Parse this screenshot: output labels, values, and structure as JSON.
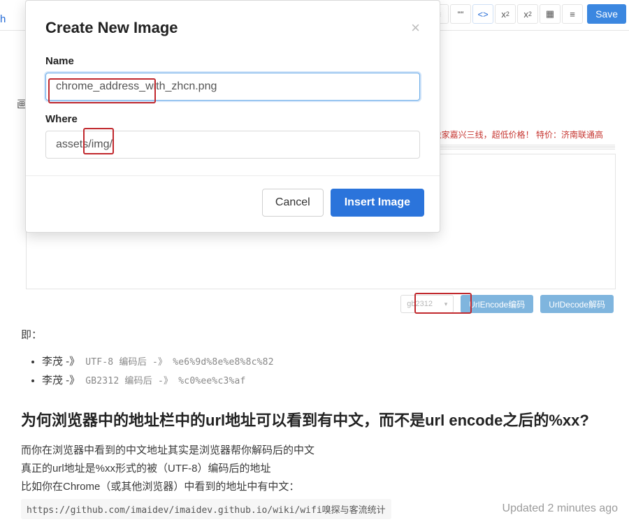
{
  "toolbar": {
    "code_label": "<>",
    "save_label": "Save",
    "sub_label": "x",
    "sup_label": "x"
  },
  "modal": {
    "title": "Create New Image",
    "labels": {
      "name": "Name",
      "where": "Where"
    },
    "values": {
      "name": "chrome_address_with_zhcn.png",
      "where": "assets/img/"
    },
    "cancel": "Cancel",
    "submit": "Insert Image"
  },
  "ribbon": {
    "red_text": "快快独家嘉兴三线，超低价格！   特价：济南联通高",
    "select_value": "gb2312",
    "encode_btn": "UrlEncode编码",
    "decode_btn": "UrlDecode解码"
  },
  "article": {
    "lead": "即：",
    "bullets": [
      {
        "prefix": "李茂 -》",
        "enc": "  UTF-8 编码后 -》  %e6%9d%8e%e8%8c%82"
      },
      {
        "prefix": "李茂 -》",
        "enc": "  GB2312 编码后 -》  %c0%ee%c3%af"
      }
    ],
    "h2": "为何浏览器中的地址栏中的url地址可以看到有中文，而不是url encode之后的%xx?",
    "p1": "而你在浏览器中看到的中文地址其实是浏览器帮你解码后的中文",
    "p2": "真正的url地址是%xx形式的被（UTF-8）编码后的地址",
    "p3": "比如你在Chrome（或其他浏览器）中看到的地址中有中文：",
    "code": "https://github.com/imaidev/imaidev.github.io/wiki/wifi嗅探与客流统计"
  },
  "meta": {
    "updated": "Updated 2 minutes ago",
    "left_cut": "h",
    "small_char": "画"
  }
}
